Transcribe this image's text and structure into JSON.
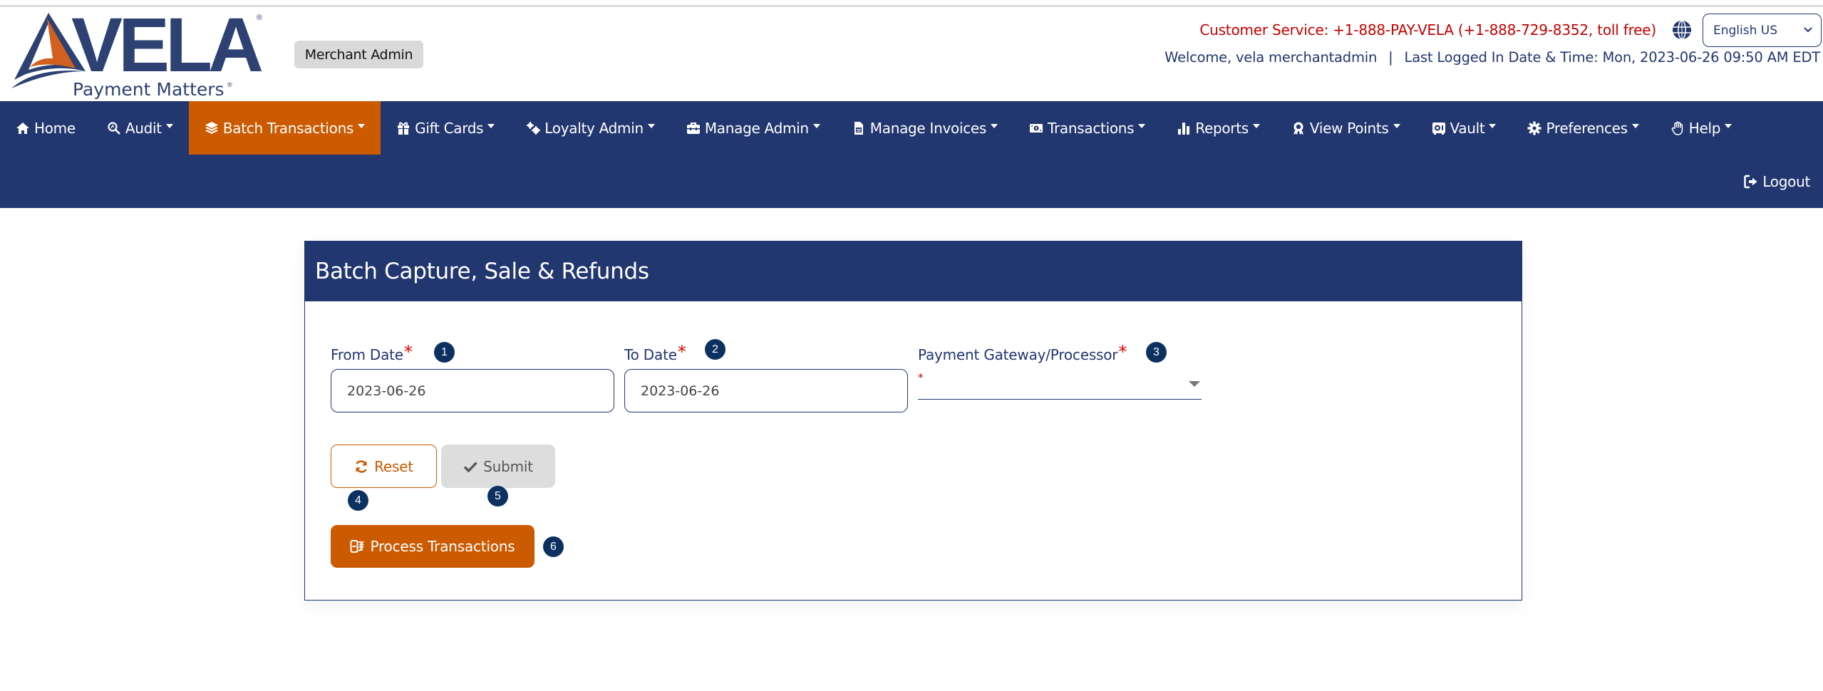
{
  "header": {
    "logo": {
      "brand": "VELA",
      "tagline": "Payment Matters",
      "registered": "®"
    },
    "role_badge": "Merchant Admin",
    "customer_service": "Customer Service: +1-888-PAY-VELA (+1-888-729-8352, toll free)",
    "language": {
      "selected": "English US",
      "icon": "globe-icon"
    },
    "welcome_prefix": "Welcome, ",
    "username": "vela merchantadmin",
    "separator": "|",
    "last_login_label": "Last Logged In Date & Time: ",
    "last_login_value": "Mon, 2023-06-26 09:50 AM EDT"
  },
  "nav": {
    "items": [
      {
        "label": "Home",
        "icon": "home-icon",
        "dropdown": false,
        "active": false
      },
      {
        "label": "Audit",
        "icon": "search-icon",
        "dropdown": true,
        "active": false
      },
      {
        "label": "Batch Transactions",
        "icon": "layers-icon",
        "dropdown": true,
        "active": true
      },
      {
        "label": "Gift Cards",
        "icon": "gift-icon",
        "dropdown": true,
        "active": false
      },
      {
        "label": "Loyalty Admin",
        "icon": "gears-icon",
        "dropdown": true,
        "active": false
      },
      {
        "label": "Manage Admin",
        "icon": "toolbox-icon",
        "dropdown": true,
        "active": false
      },
      {
        "label": "Manage Invoices",
        "icon": "invoice-icon",
        "dropdown": true,
        "active": false
      },
      {
        "label": "Transactions",
        "icon": "money-bill-icon",
        "dropdown": true,
        "active": false
      },
      {
        "label": "Reports",
        "icon": "bar-chart-icon",
        "dropdown": true,
        "active": false
      },
      {
        "label": "View Points",
        "icon": "award-icon",
        "dropdown": true,
        "active": false
      },
      {
        "label": "Vault",
        "icon": "vault-icon",
        "dropdown": true,
        "active": false
      },
      {
        "label": "Preferences",
        "icon": "gear-icon",
        "dropdown": true,
        "active": false
      },
      {
        "label": "Help",
        "icon": "hand-icon",
        "dropdown": true,
        "active": false
      }
    ],
    "logout": {
      "label": "Logout",
      "icon": "logout-icon"
    }
  },
  "page": {
    "title": "Batch Capture, Sale & Refunds",
    "fields": {
      "from_date": {
        "label": "From Date",
        "required": "*",
        "value": "2023-06-26",
        "step": "1"
      },
      "to_date": {
        "label": "To Date",
        "required": "*",
        "value": "2023-06-26",
        "step": "2"
      },
      "gateway": {
        "label": "Payment Gateway/Processor",
        "required": "*",
        "value": "",
        "inner_marker": "*",
        "step": "3"
      }
    },
    "buttons": {
      "reset": {
        "label": "Reset",
        "icon": "refresh-icon",
        "step": "4"
      },
      "submit": {
        "label": "Submit",
        "icon": "check-icon",
        "step": "5"
      },
      "process": {
        "label": "Process Transactions",
        "icon": "process-icon",
        "step": "6"
      }
    }
  },
  "colors": {
    "navy": "#22376f",
    "orange": "#cc5a00",
    "step_badge": "#0c3060",
    "required_red": "#e00000",
    "customer_service_red": "#c40000"
  }
}
